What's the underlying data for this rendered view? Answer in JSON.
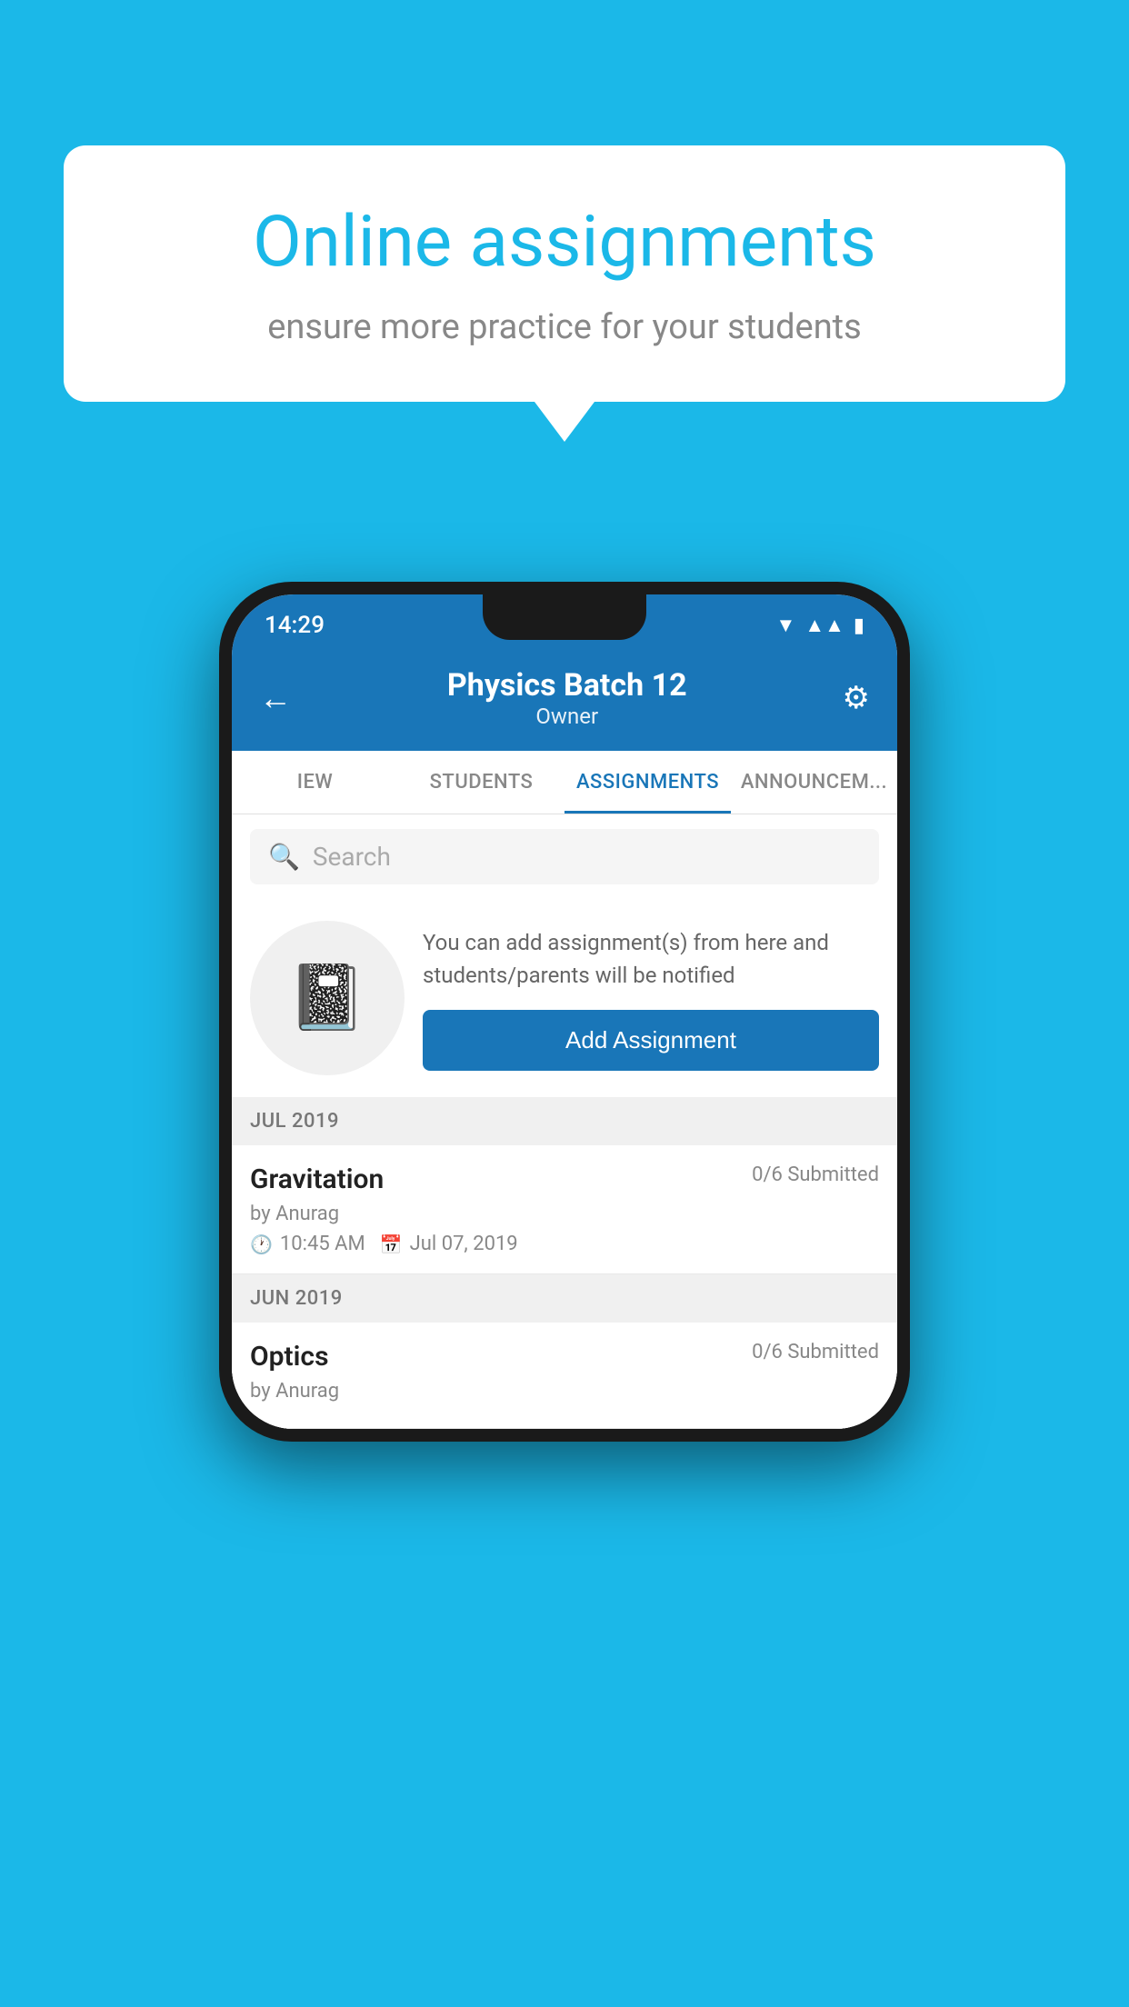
{
  "background_color": "#1bb8e8",
  "speech_bubble": {
    "title": "Online assignments",
    "subtitle": "ensure more practice for your students"
  },
  "status_bar": {
    "time": "14:29",
    "wifi": "▼",
    "signal": "▲",
    "battery": "▮"
  },
  "app_bar": {
    "title": "Physics Batch 12",
    "subtitle": "Owner",
    "back_label": "←",
    "settings_label": "⚙"
  },
  "tabs": [
    {
      "label": "IEW",
      "active": false
    },
    {
      "label": "STUDENTS",
      "active": false
    },
    {
      "label": "ASSIGNMENTS",
      "active": true
    },
    {
      "label": "ANNOUNCEM...",
      "active": false
    }
  ],
  "search": {
    "placeholder": "Search"
  },
  "promo_card": {
    "description": "You can add assignment(s) from here and students/parents will be notified",
    "button_label": "Add Assignment"
  },
  "sections": [
    {
      "label": "JUL 2019",
      "assignments": [
        {
          "title": "Gravitation",
          "submitted": "0/6 Submitted",
          "by": "by Anurag",
          "time": "10:45 AM",
          "date": "Jul 07, 2019"
        }
      ]
    },
    {
      "label": "JUN 2019",
      "assignments": [
        {
          "title": "Optics",
          "submitted": "0/6 Submitted",
          "by": "by Anurag",
          "time": "",
          "date": ""
        }
      ]
    }
  ]
}
